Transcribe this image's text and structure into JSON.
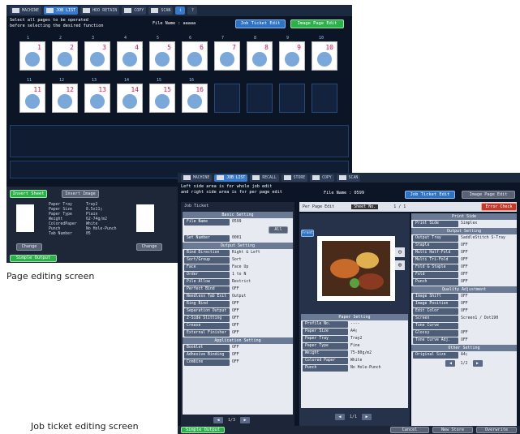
{
  "page_screen": {
    "tabs": [
      "MACHINE",
      "JOB LIST",
      "HDD RETAIN",
      "COPY",
      "SCAN"
    ],
    "instruction": [
      "Select all pages to be operated",
      "before selecting the desired function"
    ],
    "file_name_label": "File Name",
    "file_name_value": "aaaaa",
    "job_ticket_btn": "Job Ticket Edit",
    "image_page_btn": "Image Page Edit",
    "row1": [
      "1",
      "2",
      "3",
      "4",
      "5",
      "6",
      "7",
      "8",
      "9",
      "10"
    ],
    "row2": [
      "11",
      "12",
      "13",
      "14",
      "15",
      "16"
    ],
    "insert_sheet": "Insert Sheet",
    "insert_image": "Insert Image",
    "paper_info": [
      {
        "k": "Paper Tray",
        "v": "Tray2"
      },
      {
        "k": "Paper Size",
        "v": "8.5x11▯"
      },
      {
        "k": "Paper Type",
        "v": "Plain"
      },
      {
        "k": "Weight",
        "v": "62-74g/m2"
      },
      {
        "k": "ColoredPaper",
        "v": "White"
      },
      {
        "k": "Punch",
        "v": "No Hole-Punch"
      },
      {
        "k": "Tab Number",
        "v": "05"
      }
    ],
    "change_label": "Change",
    "simple_output": "Simple Output"
  },
  "caption_page": "Page editing screen",
  "caption_job": "Job ticket editing screen",
  "job_screen": {
    "tabs": [
      "MACHINE",
      "JOB LIST",
      "RECALL",
      "STORE",
      "COPY",
      "SCAN"
    ],
    "instruction": [
      "Left side area is for whole job edit",
      "and right side area is for per page edit"
    ],
    "file_name_label": "File Name :",
    "file_name_value": "0599",
    "job_ticket_btn": "Job Ticket Edit",
    "image_page_btn": "Image Page Edit",
    "job_ticket_title": "Job Ticket",
    "per_page_edit": "Per Page Edit",
    "sheet_no": "Sheet No.",
    "sheet_val": "1 / 1",
    "error_check": "Error Check",
    "basic_setting": "Basic Setting",
    "file_name_k": "File Name",
    "file_name_v": "0599",
    "all_btn": "All",
    "set_number_k": "Set Number",
    "set_number_v": "0001",
    "output_setting": "Output Setting",
    "output_rows": [
      {
        "k": "Bind Direction",
        "v": "Right & Left"
      },
      {
        "k": "Sort/Group",
        "v": "Sort"
      },
      {
        "k": "Face",
        "v": "Face Up"
      },
      {
        "k": "Order",
        "v": "1 to N"
      },
      {
        "k": "Pile Allow",
        "v": "Restrict"
      },
      {
        "k": "Perfect Bind",
        "v": "OFF"
      },
      {
        "k": "Needless Tab Exit",
        "v": "Output"
      },
      {
        "k": "Ring Bind",
        "v": "OFF"
      },
      {
        "k": "Separation Output",
        "v": "OFF"
      },
      {
        "k": "2-Side Slitting",
        "v": "OFF"
      },
      {
        "k": "Crease",
        "v": "OFF"
      },
      {
        "k": "External Finisher",
        "v": "OFF"
      }
    ],
    "app_setting": "Application Setting",
    "app_rows": [
      {
        "k": "Booklet",
        "v": "OFF"
      },
      {
        "k": "Adhesive Binding",
        "v": "OFF"
      },
      {
        "k": "Combine",
        "v": "OFF"
      }
    ],
    "left_page": "1/3",
    "front_label": "Front",
    "paper_setting": "Paper Setting",
    "paper_rows": [
      {
        "k": "Profile No.",
        "v": "----"
      },
      {
        "k": "Paper Size",
        "v": "A4▯"
      },
      {
        "k": "Paper Tray",
        "v": "Tray2"
      },
      {
        "k": "Paper Type",
        "v": "Fine"
      },
      {
        "k": "Weight",
        "v": "75-80g/m2"
      },
      {
        "k": "Colored Paper",
        "v": "White"
      },
      {
        "k": "Punch",
        "v": "No Hole-Punch"
      }
    ],
    "mid_page": "1/1",
    "print_side_title": "Print Side",
    "print_side": {
      "k": "Print Side",
      "v": "Simplex"
    },
    "right_output_title": "Output Setting",
    "right_output_rows": [
      {
        "k": "Output Tray",
        "v": "SaddleStitch S-Tray"
      },
      {
        "k": "Staple",
        "v": "OFF"
      },
      {
        "k": "Multi Half-Fold",
        "v": "OFF"
      },
      {
        "k": "Multi Tri-Fold",
        "v": "OFF"
      },
      {
        "k": "Fold & Staple",
        "v": "OFF"
      },
      {
        "k": "Fold",
        "v": "OFF"
      },
      {
        "k": "Punch",
        "v": "OFF"
      }
    ],
    "quality_title": "Quality Adjustment",
    "quality_rows": [
      {
        "k": "Image Shift",
        "v": "OFF"
      },
      {
        "k": "Image Position",
        "v": "OFF"
      },
      {
        "k": "Edit Color",
        "v": "OFF"
      },
      {
        "k": "Screen",
        "v": "Screen1 / Dot190"
      },
      {
        "k": "Tone Curve",
        "v": ""
      },
      {
        "k": "Glossy",
        "v": "OFF"
      },
      {
        "k": "Tone Curve Adj.",
        "v": "OFF"
      }
    ],
    "other_title": "Other Setting",
    "original_size": {
      "k": "Original Size",
      "v": "A4▯"
    },
    "right_page": "1/2",
    "simple_output": "Simple Output",
    "cancel": "Cancel",
    "new_store": "New Store",
    "overwrite": "Overwrite"
  }
}
